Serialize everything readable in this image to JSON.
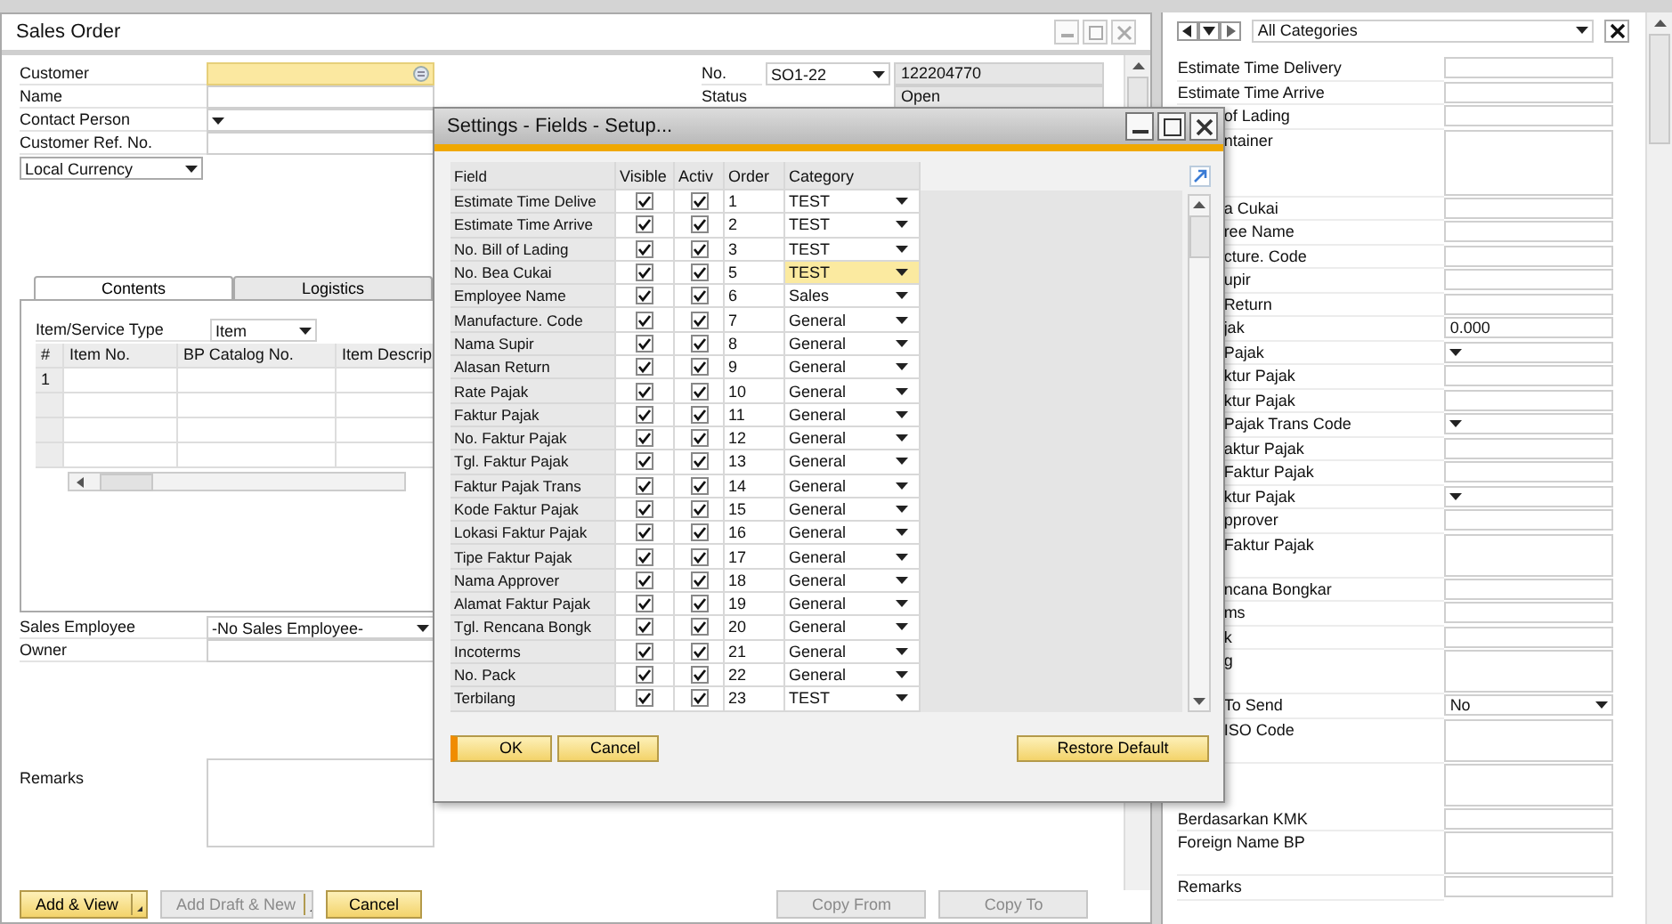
{
  "sales_order": {
    "title": "Sales Order",
    "header_fields": [
      {
        "label": "Customer",
        "kind": "lookup",
        "focused": true
      },
      {
        "label": "Name",
        "kind": "text",
        "focused": false
      },
      {
        "label": "Contact Person",
        "kind": "dropdown",
        "focused": false
      },
      {
        "label": "Customer Ref. No.",
        "kind": "text",
        "focused": false
      }
    ],
    "currency": {
      "value": "Local Currency"
    },
    "number": {
      "label": "No.",
      "series": "SO1-22",
      "value": "122204770"
    },
    "status": {
      "label": "Status",
      "value": "Open"
    },
    "tabs": [
      {
        "label": "Contents",
        "selected": true
      },
      {
        "label": "Logistics",
        "selected": false
      }
    ],
    "item_type": {
      "label": "Item/Service Type",
      "value": "Item"
    },
    "grid": {
      "columns": [
        "#",
        "Item No.",
        "BP Catalog No.",
        "Item Descrip"
      ],
      "rows": [
        {
          "number": "1"
        }
      ]
    },
    "sales_employee": {
      "label": "Sales Employee",
      "value": "-No Sales Employee-"
    },
    "owner": {
      "label": "Owner"
    },
    "remarks": {
      "label": "Remarks"
    },
    "buttons": [
      {
        "label": "Add & View",
        "kind": "split",
        "disabled": false
      },
      {
        "label": "Add Draft & New",
        "kind": "split",
        "disabled": true
      },
      {
        "label": "Cancel",
        "kind": "plain",
        "disabled": false
      },
      {
        "label": "Copy From",
        "kind": "plain",
        "disabled": true
      },
      {
        "label": "Copy To",
        "kind": "plain",
        "disabled": true
      }
    ]
  },
  "udf_panel": {
    "category": "All Categories",
    "fields_above_dialog": [
      {
        "label": "Estimate Time Delivery",
        "kind": "text"
      },
      {
        "label": "Estimate Time Arrive",
        "kind": "text"
      }
    ],
    "fields_beside_dialog": [
      {
        "label": "of Lading",
        "kind": "text"
      },
      {
        "label": "ntainer",
        "kind": "memo"
      },
      {
        "label": "a Cukai",
        "kind": "text"
      },
      {
        "label": "ree Name",
        "kind": "text"
      },
      {
        "label": "cture. Code",
        "kind": "text"
      },
      {
        "label": "upir",
        "kind": "text"
      },
      {
        "label": "Return",
        "kind": "text"
      },
      {
        "label": "jak",
        "kind": "text",
        "value": "0.000"
      },
      {
        "label": "Pajak",
        "kind": "dropdown"
      },
      {
        "label": "ktur Pajak",
        "kind": "text"
      },
      {
        "label": "ktur Pajak",
        "kind": "text"
      },
      {
        "label": "Pajak Trans Code",
        "kind": "dropdown"
      },
      {
        "label": "aktur Pajak",
        "kind": "text"
      },
      {
        "label": "Faktur Pajak",
        "kind": "text"
      },
      {
        "label": "ktur Pajak",
        "kind": "dropdown"
      },
      {
        "label": "pprover",
        "kind": "text"
      },
      {
        "label": "Faktur Pajak",
        "kind": "memo"
      },
      {
        "label": "ncana Bongkar",
        "kind": "text"
      },
      {
        "label": "ms",
        "kind": "text"
      },
      {
        "label": "k",
        "kind": "text"
      },
      {
        "label": "g",
        "kind": "memo"
      },
      {
        "label": "To Send",
        "kind": "dropdown",
        "value": "No"
      },
      {
        "label": "ISO Code",
        "kind": "memo"
      },
      {
        "kind": "memo"
      }
    ],
    "fields_below_dialog": [
      {
        "label": "Berdasarkan KMK",
        "kind": "text"
      },
      {
        "label": "Foreign Name BP",
        "kind": "memo"
      },
      {
        "label": "Remarks",
        "kind": "text"
      }
    ]
  },
  "dialog": {
    "title": "Settings - Fields - Setup...",
    "columns": [
      "Field",
      "Visible",
      "Activ",
      "Order",
      "Category"
    ],
    "rows": [
      {
        "field": "Estimate Time Delive",
        "visible": true,
        "active": true,
        "order": "1",
        "category": "TEST",
        "selected": false
      },
      {
        "field": "Estimate Time Arrive",
        "visible": true,
        "active": true,
        "order": "2",
        "category": "TEST",
        "selected": false
      },
      {
        "field": "No. Bill of Lading",
        "visible": true,
        "active": true,
        "order": "3",
        "category": "TEST",
        "selected": false
      },
      {
        "field": "No. Bea Cukai",
        "visible": true,
        "active": true,
        "order": "5",
        "category": "TEST",
        "selected": true
      },
      {
        "field": "Employee Name",
        "visible": true,
        "active": true,
        "order": "6",
        "category": "Sales",
        "selected": false
      },
      {
        "field": "Manufacture. Code",
        "visible": true,
        "active": true,
        "order": "7",
        "category": "General",
        "selected": false
      },
      {
        "field": "Nama Supir",
        "visible": true,
        "active": true,
        "order": "8",
        "category": "General",
        "selected": false
      },
      {
        "field": "Alasan Return",
        "visible": true,
        "active": true,
        "order": "9",
        "category": "General",
        "selected": false
      },
      {
        "field": "Rate Pajak",
        "visible": true,
        "active": true,
        "order": "10",
        "category": "General",
        "selected": false
      },
      {
        "field": "Faktur Pajak",
        "visible": true,
        "active": true,
        "order": "11",
        "category": "General",
        "selected": false
      },
      {
        "field": "No. Faktur Pajak",
        "visible": true,
        "active": true,
        "order": "12",
        "category": "General",
        "selected": false
      },
      {
        "field": "Tgl. Faktur Pajak",
        "visible": true,
        "active": true,
        "order": "13",
        "category": "General",
        "selected": false
      },
      {
        "field": "Faktur Pajak Trans",
        "visible": true,
        "active": true,
        "order": "14",
        "category": "General",
        "selected": false
      },
      {
        "field": "Kode Faktur Pajak",
        "visible": true,
        "active": true,
        "order": "15",
        "category": "General",
        "selected": false
      },
      {
        "field": "Lokasi Faktur Pajak",
        "visible": true,
        "active": true,
        "order": "16",
        "category": "General",
        "selected": false
      },
      {
        "field": "Tipe Faktur Pajak",
        "visible": true,
        "active": true,
        "order": "17",
        "category": "General",
        "selected": false
      },
      {
        "field": "Nama Approver",
        "visible": true,
        "active": true,
        "order": "18",
        "category": "General",
        "selected": false
      },
      {
        "field": "Alamat Faktur Pajak",
        "visible": true,
        "active": true,
        "order": "19",
        "category": "General",
        "selected": false
      },
      {
        "field": "Tgl. Rencana Bongk",
        "visible": true,
        "active": true,
        "order": "20",
        "category": "General",
        "selected": false
      },
      {
        "field": "Incoterms",
        "visible": true,
        "active": true,
        "order": "21",
        "category": "General",
        "selected": false
      },
      {
        "field": "No. Pack",
        "visible": true,
        "active": true,
        "order": "22",
        "category": "General",
        "selected": false
      },
      {
        "field": "Terbilang",
        "visible": true,
        "active": true,
        "order": "23",
        "category": "TEST",
        "selected": false
      }
    ],
    "buttons": [
      {
        "label": "OK",
        "kind": "default"
      },
      {
        "label": "Cancel",
        "kind": "plain"
      },
      {
        "label": "Restore Default",
        "kind": "plain"
      }
    ]
  }
}
